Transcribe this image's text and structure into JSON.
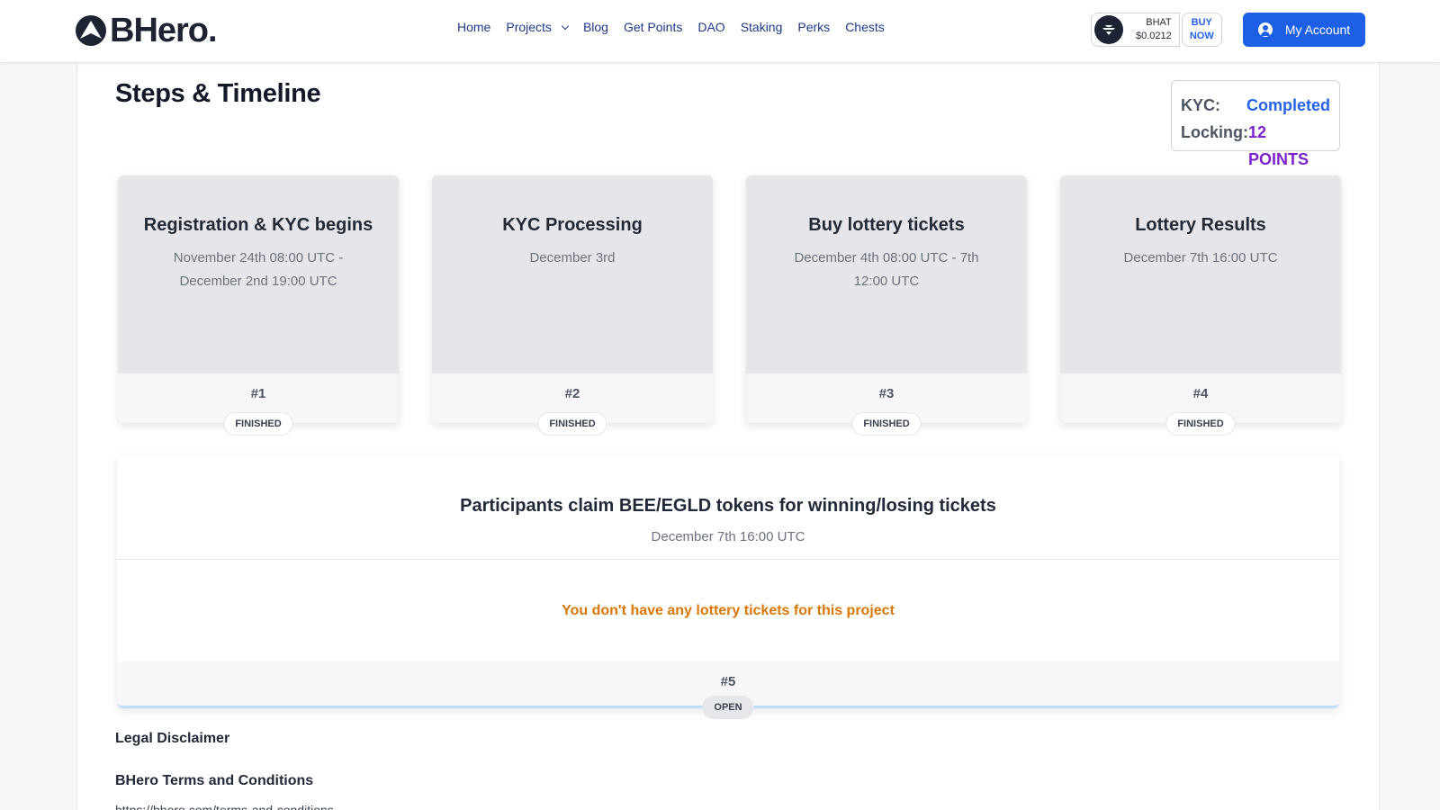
{
  "header": {
    "logo_text": "BHero.",
    "nav": [
      {
        "label": "Home"
      },
      {
        "label": "Projects"
      },
      {
        "label": "Blog"
      },
      {
        "label": "Get Points"
      },
      {
        "label": "DAO"
      },
      {
        "label": "Staking"
      },
      {
        "label": "Perks"
      },
      {
        "label": "Chests"
      }
    ],
    "token": {
      "symbol": "BHAT",
      "price": "$0.0212",
      "buy_line1": "BUY",
      "buy_line2": "NOW"
    },
    "account_label": "My Account"
  },
  "main": {
    "title": "Steps & Timeline",
    "status": {
      "kyc_label": "KYC:",
      "kyc_value": "Completed",
      "locking_label": "Locking:",
      "locking_value": "12 POINTS"
    },
    "steps": [
      {
        "title": "Registration & KYC begins",
        "date": "November 24th 08:00 UTC - December 2nd 19:00 UTC",
        "num": "#1",
        "status": "FINISHED"
      },
      {
        "title": "KYC Processing",
        "date": "December 3rd",
        "num": "#2",
        "status": "FINISHED"
      },
      {
        "title": "Buy lottery tickets",
        "date": "December 4th 08:00 UTC - 7th 12:00 UTC",
        "num": "#3",
        "status": "FINISHED"
      },
      {
        "title": "Lottery Results",
        "date": "December 7th 16:00 UTC",
        "num": "#4",
        "status": "FINISHED"
      }
    ],
    "claim": {
      "title": "Participants claim BEE/EGLD tokens for winning/losing tickets",
      "date": "December 7th 16:00 UTC",
      "message": "You don't have any lottery tickets for this project",
      "num": "#5",
      "status": "OPEN"
    },
    "legal_title": "Legal Disclaimer",
    "terms_title": "BHero Terms and Conditions",
    "terms_link": "https://bhero.com/terms-and-conditions"
  },
  "colors": {
    "accent": "#1d5fe6",
    "kyc_completed": "#2563eb",
    "locking": "#7e22ce",
    "warning": "#d97706"
  }
}
